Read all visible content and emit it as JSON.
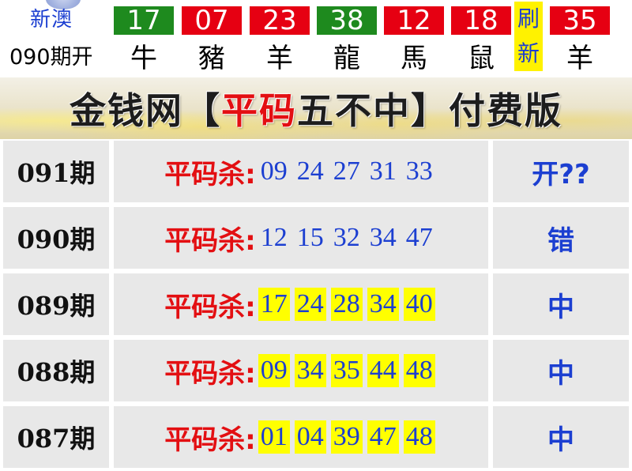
{
  "header": {
    "region": "新澳",
    "issue_open": "090期开",
    "refresh": [
      "刷",
      "新"
    ],
    "balls": [
      {
        "number": "17",
        "zodiac": "牛",
        "color": "#1e8a1e"
      },
      {
        "number": "07",
        "zodiac": "豬",
        "color": "#e60012"
      },
      {
        "number": "23",
        "zodiac": "羊",
        "color": "#e60012"
      },
      {
        "number": "38",
        "zodiac": "龍",
        "color": "#1e8a1e"
      },
      {
        "number": "12",
        "zodiac": "馬",
        "color": "#e60012"
      },
      {
        "number": "18",
        "zodiac": "鼠",
        "color": "#e60012"
      },
      {
        "number": "35",
        "zodiac": "羊",
        "color": "#e60012"
      }
    ]
  },
  "banner": {
    "prefix": "金钱网【",
    "highlight": "平码",
    "suffix": "五不中】付费版"
  },
  "table": {
    "label": "平码杀:",
    "rows": [
      {
        "issue": "091期",
        "numbers": [
          "09",
          "24",
          "27",
          "31",
          "33"
        ],
        "highlighted": false,
        "result": "开??"
      },
      {
        "issue": "090期",
        "numbers": [
          "12",
          "15",
          "32",
          "34",
          "47"
        ],
        "highlighted": false,
        "result": "错"
      },
      {
        "issue": "089期",
        "numbers": [
          "17",
          "24",
          "28",
          "34",
          "40"
        ],
        "highlighted": true,
        "result": "中"
      },
      {
        "issue": "088期",
        "numbers": [
          "09",
          "34",
          "35",
          "44",
          "48"
        ],
        "highlighted": true,
        "result": "中"
      },
      {
        "issue": "087期",
        "numbers": [
          "01",
          "04",
          "39",
          "47",
          "48"
        ],
        "highlighted": true,
        "result": "中"
      }
    ]
  },
  "colors": {
    "green_ball": "#1e8a1e",
    "red_ball": "#e60012",
    "blue_text": "#1c3fd1",
    "red_text": "#e30f12",
    "highlight": "#ffff00"
  }
}
